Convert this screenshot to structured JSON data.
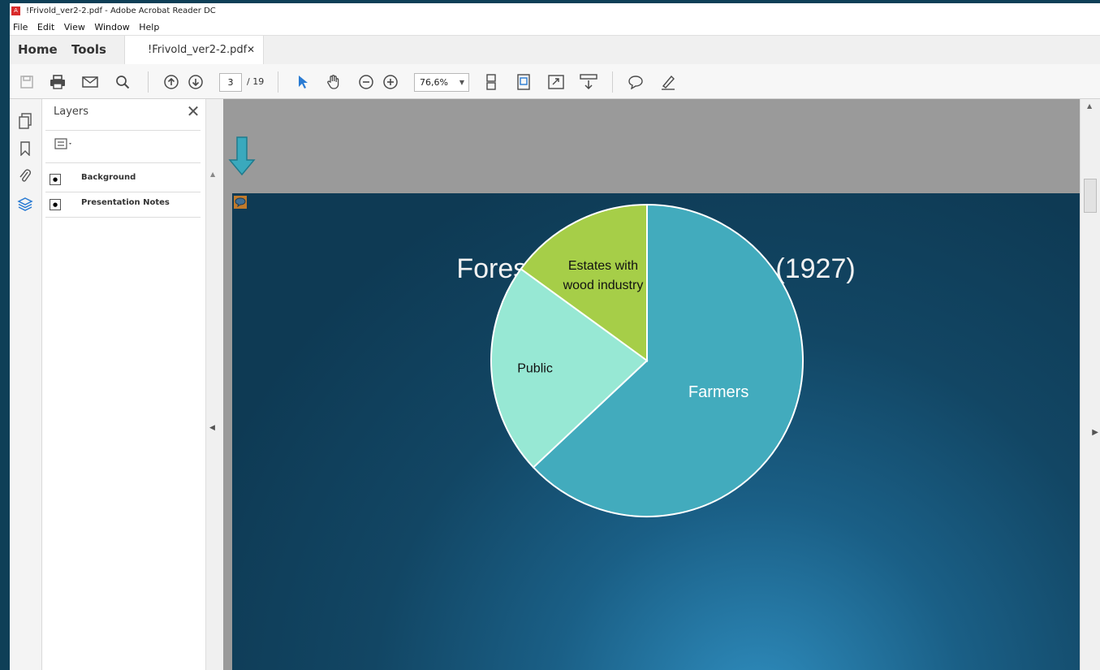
{
  "window": {
    "title": "!Frivold_ver2-2.pdf - Adobe Acrobat Reader DC"
  },
  "menu": [
    "File",
    "Edit",
    "View",
    "Window",
    "Help"
  ],
  "nav": {
    "home": "Home",
    "tools": "Tools",
    "doc_tab": "!Frivold_ver2-2.pdf"
  },
  "toolbar": {
    "current_page": "3",
    "total_pages": "/ 19",
    "zoom": "76,6%"
  },
  "layers_panel": {
    "title": "Layers",
    "layers": [
      {
        "name": "Background",
        "visible": true
      },
      {
        "name": "Presentation Notes",
        "visible": true
      }
    ]
  },
  "colors": {
    "accent_blue": "#2a7bd3",
    "farmers": "#42abbd",
    "public": "#97e8d4",
    "estates": "#a6ce48"
  },
  "chart_data": {
    "type": "pie",
    "title": "Forest area by ownership (1927)",
    "labels": [
      "Farmers",
      "Public",
      "Estates with wood industry"
    ],
    "values": [
      0.63,
      0.22,
      0.15
    ],
    "colors": [
      "#42abbd",
      "#97e8d4",
      "#a6ce48"
    ],
    "label_colors": [
      "#ffffff",
      "#111111",
      "#111111"
    ],
    "start_angle_deg": 0,
    "direction": "clockwise"
  }
}
